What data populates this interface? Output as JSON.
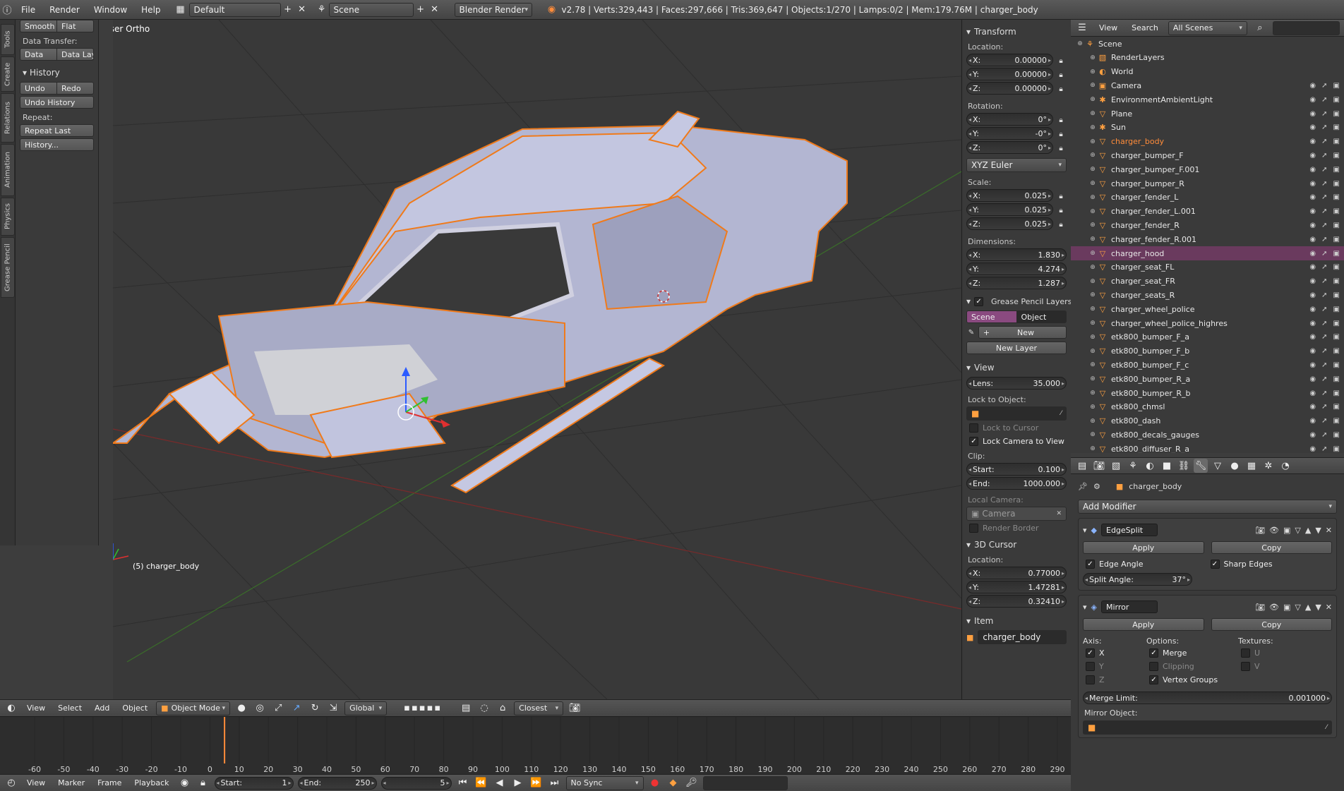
{
  "topbar": {
    "menus": [
      "File",
      "Render",
      "Window",
      "Help"
    ],
    "layout": "Default",
    "scene": "Scene",
    "engine": "Blender Render",
    "stats": "v2.78 | Verts:329,443 | Faces:297,666 | Tris:369,647 | Objects:1/270 | Lamps:0/2 | Mem:179.76M | charger_body"
  },
  "toolshelf": {
    "tabs": [
      "Tools",
      "Create",
      "Relations",
      "Animation",
      "Physics",
      "Grease Pencil"
    ],
    "smooth": "Smooth",
    "flat": "Flat",
    "data_transfer_label": "Data Transfer:",
    "data": "Data",
    "data_lay": "Data Lay",
    "history_title": "History",
    "undo": "Undo",
    "redo": "Redo",
    "undo_history": "Undo History",
    "repeat_label": "Repeat:",
    "repeat_last": "Repeat Last",
    "history_btn": "History..."
  },
  "viewport": {
    "view_label": "User Ortho",
    "object_label": "(5) charger_body"
  },
  "npanel": {
    "transform_title": "Transform",
    "location_label": "Location:",
    "loc": [
      {
        "k": "X:",
        "v": "0.00000"
      },
      {
        "k": "Y:",
        "v": "0.00000"
      },
      {
        "k": "Z:",
        "v": "0.00000"
      }
    ],
    "rotation_label": "Rotation:",
    "rot": [
      {
        "k": "X:",
        "v": "0°"
      },
      {
        "k": "Y:",
        "v": "-0°"
      },
      {
        "k": "Z:",
        "v": "0°"
      }
    ],
    "rot_mode": "XYZ Euler",
    "scale_label": "Scale:",
    "scale": [
      {
        "k": "X:",
        "v": "0.025"
      },
      {
        "k": "Y:",
        "v": "0.025"
      },
      {
        "k": "Z:",
        "v": "0.025"
      }
    ],
    "dimensions_label": "Dimensions:",
    "dims": [
      {
        "k": "X:",
        "v": "1.830"
      },
      {
        "k": "Y:",
        "v": "4.274"
      },
      {
        "k": "Z:",
        "v": "1.287"
      }
    ],
    "gp_title": "Grease Pencil Layers",
    "gp_scene": "Scene",
    "gp_object": "Object",
    "gp_new": "New",
    "gp_new_layer": "New Layer",
    "view_title": "View",
    "lens_k": "Lens:",
    "lens_v": "35.000",
    "lock_to_object": "Lock to Object:",
    "lock_to_cursor": "Lock to Cursor",
    "lock_camera_to_view": "Lock Camera to View",
    "clip_label": "Clip:",
    "clip_start_k": "Start:",
    "clip_start_v": "0.100",
    "clip_end_k": "End:",
    "clip_end_v": "1000.000",
    "local_camera_label": "Local Camera:",
    "local_camera": "Camera",
    "render_border": "Render Border",
    "cursor_title": "3D Cursor",
    "cursor_location_label": "Location:",
    "cursor": [
      {
        "k": "X:",
        "v": "0.77000"
      },
      {
        "k": "Y:",
        "v": "1.47281"
      },
      {
        "k": "Z:",
        "v": "0.32410"
      }
    ],
    "item_title": "Item",
    "item_name": "charger_body"
  },
  "outliner": {
    "view": "View",
    "search": "Search",
    "filter": "All Scenes",
    "rows": [
      {
        "name": "Scene",
        "icon": "scene-icon",
        "indent": 1,
        "sel": false
      },
      {
        "name": "RenderLayers",
        "icon": "renderlayers-icon",
        "indent": 2,
        "sel": false
      },
      {
        "name": "World",
        "icon": "world-icon",
        "indent": 2,
        "sel": false
      },
      {
        "name": "Camera",
        "icon": "camera-icon",
        "indent": 2,
        "sel": false
      },
      {
        "name": "EnvironmentAmbientLight",
        "icon": "lamp-icon",
        "indent": 2,
        "sel": false
      },
      {
        "name": "Plane",
        "icon": "mesh-icon",
        "indent": 2,
        "sel": false
      },
      {
        "name": "Sun",
        "icon": "lamp-icon",
        "indent": 2,
        "sel": false
      },
      {
        "name": "charger_body",
        "icon": "mesh-icon",
        "indent": 2,
        "sel": false,
        "active": true
      },
      {
        "name": "charger_bumper_F",
        "icon": "mesh-icon",
        "indent": 2,
        "sel": false
      },
      {
        "name": "charger_bumper_F.001",
        "icon": "mesh-icon",
        "indent": 2,
        "sel": false
      },
      {
        "name": "charger_bumper_R",
        "icon": "mesh-icon",
        "indent": 2,
        "sel": false
      },
      {
        "name": "charger_fender_L",
        "icon": "mesh-icon",
        "indent": 2,
        "sel": false
      },
      {
        "name": "charger_fender_L.001",
        "icon": "mesh-icon",
        "indent": 2,
        "sel": false
      },
      {
        "name": "charger_fender_R",
        "icon": "mesh-icon",
        "indent": 2,
        "sel": false
      },
      {
        "name": "charger_fender_R.001",
        "icon": "mesh-icon",
        "indent": 2,
        "sel": false
      },
      {
        "name": "charger_hood",
        "icon": "mesh-icon",
        "indent": 2,
        "sel": true
      },
      {
        "name": "charger_seat_FL",
        "icon": "mesh-icon",
        "indent": 2,
        "sel": false
      },
      {
        "name": "charger_seat_FR",
        "icon": "mesh-icon",
        "indent": 2,
        "sel": false
      },
      {
        "name": "charger_seats_R",
        "icon": "mesh-icon",
        "indent": 2,
        "sel": false
      },
      {
        "name": "charger_wheel_police",
        "icon": "mesh-icon",
        "indent": 2,
        "sel": false
      },
      {
        "name": "charger_wheel_police_highres",
        "icon": "mesh-icon",
        "indent": 2,
        "sel": false
      },
      {
        "name": "etk800_bumper_F_a",
        "icon": "mesh-icon",
        "indent": 2,
        "sel": false
      },
      {
        "name": "etk800_bumper_F_b",
        "icon": "mesh-icon",
        "indent": 2,
        "sel": false
      },
      {
        "name": "etk800_bumper_F_c",
        "icon": "mesh-icon",
        "indent": 2,
        "sel": false
      },
      {
        "name": "etk800_bumper_R_a",
        "icon": "mesh-icon",
        "indent": 2,
        "sel": false
      },
      {
        "name": "etk800_bumper_R_b",
        "icon": "mesh-icon",
        "indent": 2,
        "sel": false
      },
      {
        "name": "etk800_chmsl",
        "icon": "mesh-icon",
        "indent": 2,
        "sel": false
      },
      {
        "name": "etk800_dash",
        "icon": "mesh-icon",
        "indent": 2,
        "sel": false
      },
      {
        "name": "etk800_decals_gauges",
        "icon": "mesh-icon",
        "indent": 2,
        "sel": false
      },
      {
        "name": "etk800_diffuser_R_a",
        "icon": "mesh-icon",
        "indent": 2,
        "sel": false
      }
    ]
  },
  "properties": {
    "object_name": "charger_body",
    "add_modifier": "Add Modifier",
    "mod1_name": "EdgeSplit",
    "apply": "Apply",
    "copy": "Copy",
    "edge_angle": "Edge Angle",
    "sharp_edges": "Sharp Edges",
    "split_angle_k": "Split Angle:",
    "split_angle_v": "37°",
    "mod2_name": "Mirror",
    "axis_label": "Axis:",
    "options_label": "Options:",
    "textures_label": "Textures:",
    "x": "X",
    "y": "Y",
    "z": "Z",
    "merge": "Merge",
    "clipping": "Clipping",
    "vertex_groups": "Vertex Groups",
    "u": "U",
    "v": "V",
    "merge_limit_k": "Merge Limit:",
    "merge_limit_v": "0.001000",
    "mirror_object": "Mirror Object:"
  },
  "vpheader": {
    "view": "View",
    "select": "Select",
    "add": "Add",
    "object": "Object",
    "mode": "Object Mode",
    "orientation": "Global",
    "snap": "Closest"
  },
  "timeline": {
    "ticks": [
      "-60",
      "-50",
      "-40",
      "-30",
      "-20",
      "-10",
      "0",
      "10",
      "20",
      "30",
      "40",
      "50",
      "60",
      "70",
      "80",
      "90",
      "100",
      "110",
      "120",
      "130",
      "140",
      "150",
      "160",
      "170",
      "180",
      "190",
      "200",
      "210",
      "220",
      "230",
      "240",
      "250",
      "260",
      "270",
      "280",
      "290"
    ],
    "current_frame": 5
  },
  "tlfooter": {
    "view": "View",
    "marker": "Marker",
    "frame": "Frame",
    "playback": "Playback",
    "start_k": "Start:",
    "start_v": "1",
    "end_k": "End:",
    "end_v": "250",
    "current": "5",
    "sync": "No Sync"
  },
  "colors": {
    "selected_row": "#6a3a5e",
    "active_object_text": "#ff8c3a",
    "mesh_fill": "#b9bdd9",
    "outline": "#f07a1a"
  }
}
